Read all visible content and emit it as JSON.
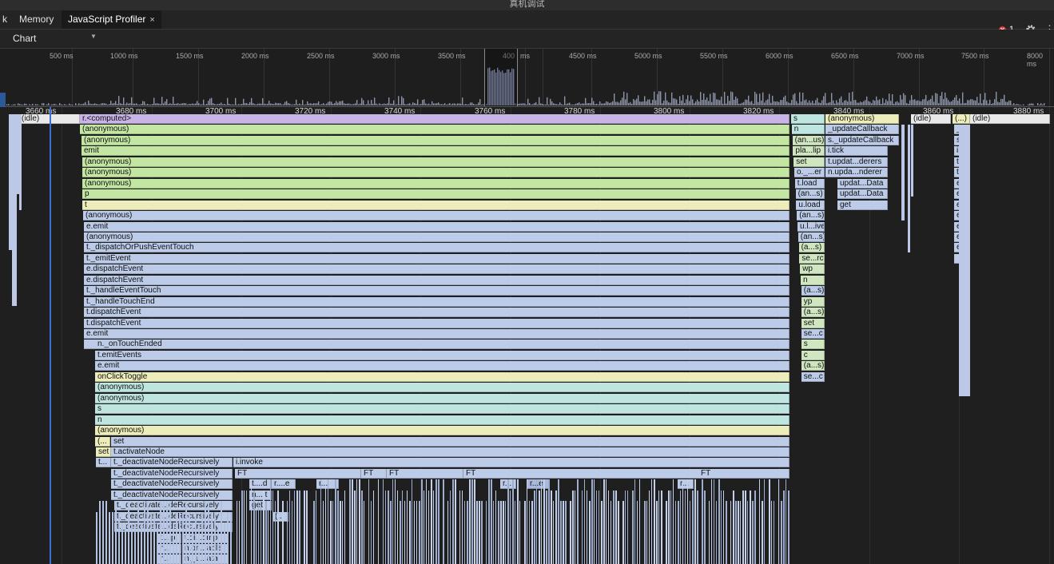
{
  "window": {
    "title": "真机调试"
  },
  "tabs": [
    {
      "label": "k",
      "active": false
    },
    {
      "label": "Memory",
      "active": false
    },
    {
      "label": "JavaScript Profiler",
      "active": true,
      "close": "×"
    }
  ],
  "status": {
    "error_count": "1",
    "error_symbol": "✕"
  },
  "toolbar": {
    "view_select": "Chart"
  },
  "overview": {
    "ticks": [
      "500 ms",
      "1000 ms",
      "1500 ms",
      "2000 ms",
      "2500 ms",
      "3000 ms",
      "3500 ms",
      "400",
      "ms",
      "4500 ms",
      "5000 ms",
      "5500 ms",
      "6000 ms",
      "6500 ms",
      "7000 ms",
      "7500 ms",
      "8000 ms"
    ]
  },
  "flame": {
    "ruler": [
      "3660 ms",
      "3680 ms",
      "3700 ms",
      "3720 ms",
      "3740 ms",
      "3760 ms",
      "3780 ms",
      "3800 ms",
      "3820 ms",
      "3840 ms",
      "3860 ms",
      "3880 ms"
    ],
    "frames": [
      "(idle)",
      "r.<computed>",
      "(anonymous)",
      "(anonymous)",
      "emit",
      "(anonymous)",
      "(anonymous)",
      "(anonymous)",
      "p",
      "t",
      "(anonymous)",
      "e.emit",
      "(anonymous)",
      "t._dispatchOrPushEventTouch",
      "t._emitEvent",
      "e.dispatchEvent",
      "e.dispatchEvent",
      "t._handleEventTouch",
      "t._handleTouchEnd",
      "t.dispatchEvent",
      "t.dispatchEvent",
      "e.emit",
      "n._onTouchEnded",
      "t.emitEvents",
      "e.emit",
      "onClickToggle",
      "(anonymous)",
      "(anonymous)",
      "s",
      "n",
      "(anonymous)",
      "(...",
      "set",
      "set",
      "t.activateNode",
      "t...",
      "t._deactivateNodeRecursively",
      "i.invoke",
      "t._deactivateNodeRecursively",
      "t._deactivateNodeRecursively",
      "t._deactivateNodeRecursively",
      "t._deactivate...deRecursively",
      "t._deactivate...deRecursively",
      "t._deactivate...deRecursively",
      "FT",
      "FT",
      "FT",
      "FT",
      "FT",
      "t....d",
      "r....e",
      "r...",
      "r...",
      "r...e",
      "r...",
      "n....t",
      "get",
      "(...",
      "t....p",
      "t.di...omp",
      "n...",
      "n.on...able",
      "n...",
      "n._u...ata",
      "s",
      "n",
      "(an...us)",
      "pla...lip",
      "set",
      "o._...er",
      "t.load",
      "(an...s)",
      "u.load",
      "(an...s)",
      "u.l...ive",
      "(an...s)",
      "(a...s)",
      "se...rc",
      "wp",
      "n",
      "(a...s)",
      "yp",
      "(a...s)",
      "set",
      "se...c",
      "s",
      "c",
      "(a...s)",
      "se...c",
      "(anonymous)",
      "_updateCallback",
      "s._updateCallback",
      "i.tick",
      "t.updat...derers",
      "n.upda...nderer",
      "updat...Data",
      "updat...Data",
      "get",
      "(idle)",
      "(...)",
      "(idle)",
      "_...",
      "s...",
      "i...k",
      "t...",
      "t...",
      "e...",
      "e...",
      "e...",
      "e...",
      "e...",
      "e...",
      "e..."
    ]
  }
}
